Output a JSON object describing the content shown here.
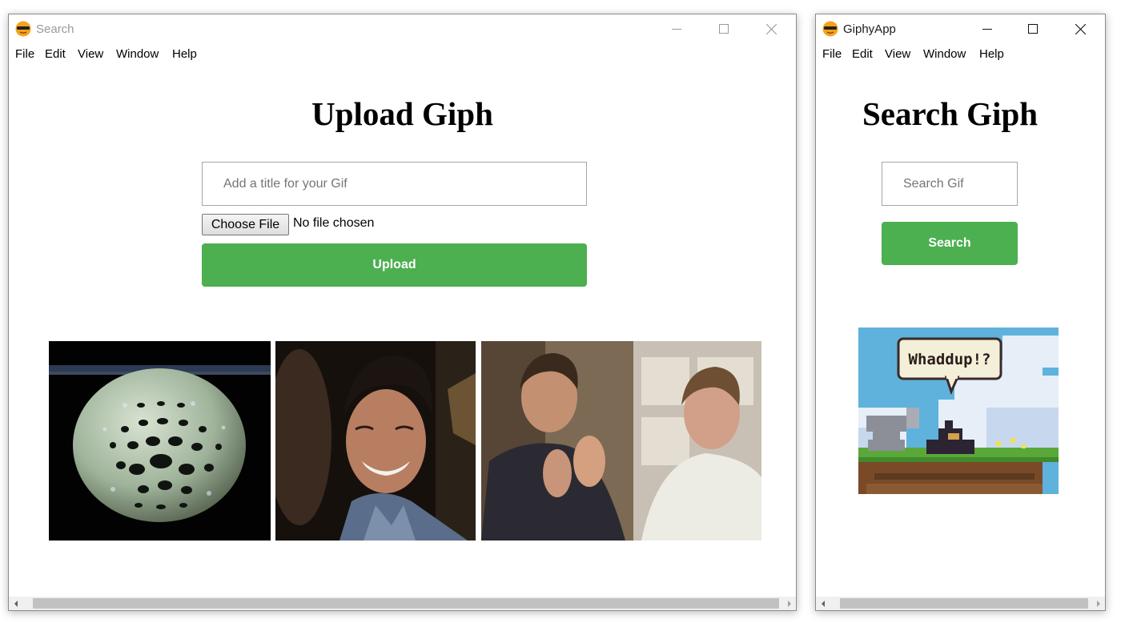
{
  "left_window": {
    "title": "Search",
    "menu": [
      "File",
      "Edit",
      "View",
      "Window",
      "Help"
    ],
    "heading": "Upload Giph",
    "title_input": {
      "value": "",
      "placeholder": "Add a title for your Gif"
    },
    "file_picker": {
      "button_label": "Choose File",
      "status": "No file chosen"
    },
    "upload_label": "Upload",
    "gifs": [
      {
        "icon": "dotted-sphere-gif"
      },
      {
        "icon": "smiling-man-gif"
      },
      {
        "icon": "two-men-clapping-gif"
      }
    ]
  },
  "right_window": {
    "title": "GiphyApp",
    "menu": [
      "File",
      "Edit",
      "View",
      "Window",
      "Help"
    ],
    "heading": "Search Giph",
    "search_input": {
      "value": "",
      "placeholder": "Search Gif"
    },
    "search_label": "Search",
    "result_gif": {
      "caption": "Whaddup!?",
      "icon": "pixel-art-creature-gif"
    }
  },
  "colors": {
    "accent_green": "#4caf50",
    "scrollbar_track": "#f0f0f0",
    "scrollbar_thumb": "#c1c1c1"
  }
}
